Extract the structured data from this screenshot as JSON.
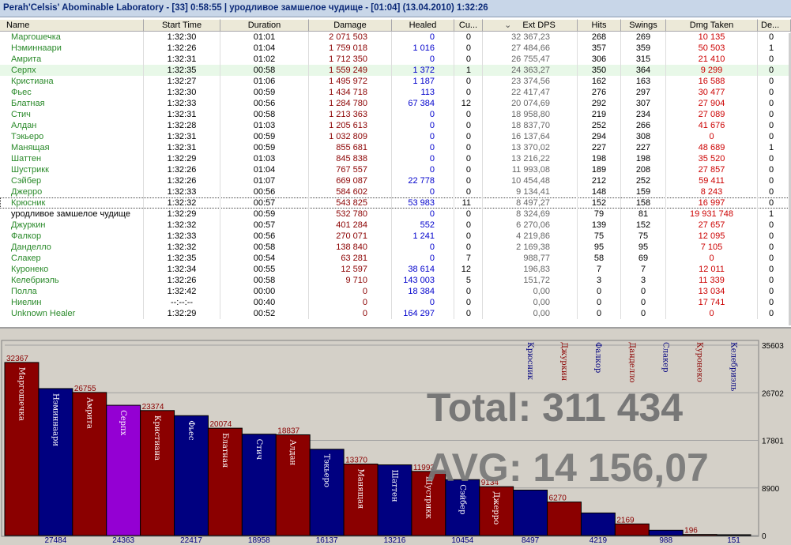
{
  "window": {
    "title": "Perah'Celsis' Abominable Laboratory - [33] 0:58:55 | уродливое замшелое чудище - [01:04] (13.04.2010) 1:32:26"
  },
  "table": {
    "columns": [
      "Name",
      "Start Time",
      "Duration",
      "Damage",
      "Healed",
      "Cu...",
      "Ext DPS",
      "Hits",
      "Swings",
      "Dmg Taken",
      "De..."
    ],
    "sort_indicator": "⌄",
    "rows": [
      {
        "name": "Маргошечка",
        "start": "1:32:30",
        "dur": "01:01",
        "dmg": "2 071 503",
        "healed": "0",
        "cu": "0",
        "dps": "32 367,23",
        "hits": "268",
        "swings": "269",
        "taken": "10 135",
        "de": "0"
      },
      {
        "name": "Нэминнаари",
        "start": "1:32:26",
        "dur": "01:04",
        "dmg": "1 759 018",
        "healed": "1 016",
        "cu": "0",
        "dps": "27 484,66",
        "hits": "357",
        "swings": "359",
        "taken": "50 503",
        "de": "1"
      },
      {
        "name": "Амрита",
        "start": "1:32:31",
        "dur": "01:02",
        "dmg": "1 712 350",
        "healed": "0",
        "cu": "0",
        "dps": "26 755,47",
        "hits": "306",
        "swings": "315",
        "taken": "21 410",
        "de": "0"
      },
      {
        "name": "Серпх",
        "start": "1:32:35",
        "dur": "00:58",
        "dmg": "1 559 249",
        "healed": "1 372",
        "cu": "1",
        "dps": "24 363,27",
        "hits": "350",
        "swings": "364",
        "taken": "9 299",
        "de": "0"
      },
      {
        "name": "Кристиана",
        "start": "1:32:27",
        "dur": "01:06",
        "dmg": "1 495 972",
        "healed": "1 187",
        "cu": "0",
        "dps": "23 374,56",
        "hits": "162",
        "swings": "163",
        "taken": "16 588",
        "de": "0"
      },
      {
        "name": "Фьес",
        "start": "1:32:30",
        "dur": "00:59",
        "dmg": "1 434 718",
        "healed": "113",
        "cu": "0",
        "dps": "22 417,47",
        "hits": "276",
        "swings": "297",
        "taken": "30 477",
        "de": "0"
      },
      {
        "name": "Блатная",
        "start": "1:32:33",
        "dur": "00:56",
        "dmg": "1 284 780",
        "healed": "67 384",
        "cu": "12",
        "dps": "20 074,69",
        "hits": "292",
        "swings": "307",
        "taken": "27 904",
        "de": "0"
      },
      {
        "name": "Стич",
        "start": "1:32:31",
        "dur": "00:58",
        "dmg": "1 213 363",
        "healed": "0",
        "cu": "0",
        "dps": "18 958,80",
        "hits": "219",
        "swings": "234",
        "taken": "27 089",
        "de": "0"
      },
      {
        "name": "Алдан",
        "start": "1:32:28",
        "dur": "01:03",
        "dmg": "1 205 613",
        "healed": "0",
        "cu": "0",
        "dps": "18 837,70",
        "hits": "252",
        "swings": "266",
        "taken": "41 676",
        "de": "0"
      },
      {
        "name": "Тэкьеро",
        "start": "1:32:31",
        "dur": "00:59",
        "dmg": "1 032 809",
        "healed": "0",
        "cu": "0",
        "dps": "16 137,64",
        "hits": "294",
        "swings": "308",
        "taken": "0",
        "de": "0"
      },
      {
        "name": "Манящая",
        "start": "1:32:31",
        "dur": "00:59",
        "dmg": "855 681",
        "healed": "0",
        "cu": "0",
        "dps": "13 370,02",
        "hits": "227",
        "swings": "227",
        "taken": "48 689",
        "de": "1"
      },
      {
        "name": "Шаттен",
        "start": "1:32:29",
        "dur": "01:03",
        "dmg": "845 838",
        "healed": "0",
        "cu": "0",
        "dps": "13 216,22",
        "hits": "198",
        "swings": "198",
        "taken": "35 520",
        "de": "0"
      },
      {
        "name": "Шустрикк",
        "start": "1:32:26",
        "dur": "01:04",
        "dmg": "767 557",
        "healed": "0",
        "cu": "0",
        "dps": "11 993,08",
        "hits": "189",
        "swings": "208",
        "taken": "27 857",
        "de": "0"
      },
      {
        "name": "Сэйбер",
        "start": "1:32:26",
        "dur": "01:07",
        "dmg": "669 087",
        "healed": "22 778",
        "cu": "0",
        "dps": "10 454,48",
        "hits": "212",
        "swings": "252",
        "taken": "59 411",
        "de": "0"
      },
      {
        "name": "Джерро",
        "start": "1:32:33",
        "dur": "00:56",
        "dmg": "584 602",
        "healed": "0",
        "cu": "0",
        "dps": "9 134,41",
        "hits": "148",
        "swings": "159",
        "taken": "8 243",
        "de": "0"
      },
      {
        "name": "Крюсник",
        "start": "1:32:32",
        "dur": "00:57",
        "dmg": "543 825",
        "healed": "53 983",
        "cu": "11",
        "dps": "8 497,27",
        "hits": "152",
        "swings": "158",
        "taken": "16 997",
        "de": "0"
      },
      {
        "name": "уродливое замшелое чудище",
        "start": "1:32:29",
        "dur": "00:59",
        "dmg": "532 780",
        "healed": "0",
        "cu": "0",
        "dps": "8 324,69",
        "hits": "79",
        "swings": "81",
        "taken": "19 931 748",
        "de": "1"
      },
      {
        "name": "Джуркин",
        "start": "1:32:32",
        "dur": "00:57",
        "dmg": "401 284",
        "healed": "552",
        "cu": "0",
        "dps": "6 270,06",
        "hits": "139",
        "swings": "152",
        "taken": "27 657",
        "de": "0"
      },
      {
        "name": "Фалкор",
        "start": "1:32:33",
        "dur": "00:56",
        "dmg": "270 071",
        "healed": "1 241",
        "cu": "0",
        "dps": "4 219,86",
        "hits": "75",
        "swings": "75",
        "taken": "12 095",
        "de": "0"
      },
      {
        "name": "Данделло",
        "start": "1:32:32",
        "dur": "00:58",
        "dmg": "138 840",
        "healed": "0",
        "cu": "0",
        "dps": "2 169,38",
        "hits": "95",
        "swings": "95",
        "taken": "7 105",
        "de": "0"
      },
      {
        "name": "Слакер",
        "start": "1:32:35",
        "dur": "00:54",
        "dmg": "63 281",
        "healed": "0",
        "cu": "7",
        "dps": "988,77",
        "hits": "58",
        "swings": "69",
        "taken": "0",
        "de": "0"
      },
      {
        "name": "Куронеко",
        "start": "1:32:34",
        "dur": "00:55",
        "dmg": "12 597",
        "healed": "38 614",
        "cu": "12",
        "dps": "196,83",
        "hits": "7",
        "swings": "7",
        "taken": "12 011",
        "de": "0"
      },
      {
        "name": "Келебриэль",
        "start": "1:32:26",
        "dur": "00:58",
        "dmg": "9 710",
        "healed": "143 003",
        "cu": "5",
        "dps": "151,72",
        "hits": "3",
        "swings": "3",
        "taken": "11 339",
        "de": "0"
      },
      {
        "name": "Полла",
        "start": "1:32:42",
        "dur": "00:00",
        "dmg": "0",
        "healed": "18 384",
        "cu": "0",
        "dps": "0,00",
        "hits": "0",
        "swings": "0",
        "taken": "13 034",
        "de": "0"
      },
      {
        "name": "Ниелин",
        "start": "--:--:--",
        "dur": "00:40",
        "dmg": "0",
        "healed": "0",
        "cu": "0",
        "dps": "0,00",
        "hits": "0",
        "swings": "0",
        "taken": "17 741",
        "de": "0"
      },
      {
        "name": "Unknown Healer",
        "start": "1:32:29",
        "dur": "00:52",
        "dmg": "0",
        "healed": "164 297",
        "cu": "0",
        "dps": "0,00",
        "hits": "0",
        "swings": "0",
        "taken": "0",
        "de": "0"
      }
    ]
  },
  "chart_data": {
    "type": "bar",
    "categories": [
      "Маргошечка",
      "Нэминнаари",
      "Амрита",
      "Серпх",
      "Кристиана",
      "Фьес",
      "Блатная",
      "Стич",
      "Алдан",
      "Тэкьеро",
      "Манящая",
      "Шаттен",
      "Шустрикк",
      "Сэйбер",
      "Джерро",
      "Крюсник",
      "Джуркин",
      "Фалкор",
      "Данделло",
      "Слакер",
      "Куронеко",
      "Келебриэль"
    ],
    "values": [
      32367,
      27484,
      26755,
      24363,
      23374,
      22417,
      20074,
      18958,
      18837,
      16137,
      13370,
      13216,
      11993,
      10454,
      9134,
      8497,
      6270,
      4219,
      2169,
      988,
      196,
      151
    ],
    "value_labels": [
      "32367",
      "27484",
      "26755",
      "24363",
      "23374",
      "22417",
      "20074",
      "18958",
      "18837",
      "16137",
      "13370",
      "13216",
      "11993",
      "10454",
      "9134",
      "8497",
      "6270",
      "4219",
      "2169",
      "988",
      "196",
      "151"
    ],
    "bar_colors": [
      "#8b0000",
      "#000080",
      "#8b0000",
      "#9400d3",
      "#8b0000",
      "#000080",
      "#8b0000",
      "#000080",
      "#8b0000",
      "#000080",
      "#8b0000",
      "#000080",
      "#8b0000",
      "#000080",
      "#8b0000",
      "#000080",
      "#8b0000",
      "#000080",
      "#8b0000",
      "#000080",
      "#8b0000",
      "#000080"
    ],
    "label_in_bar_count": 15,
    "ylim": [
      0,
      35603
    ],
    "yticks": [
      "35603",
      "26702",
      "17801",
      "8900",
      "0"
    ],
    "ytick_values": [
      35603,
      26702,
      17801,
      8900,
      0
    ],
    "grid": true,
    "total_text": "Total: 311 434",
    "avg_text": "AVG: 14 156,07"
  },
  "colors": {
    "red_bar": "#8b0000",
    "blue_bar": "#000080",
    "highlight_bar": "#9400d3",
    "player_name": "#2a8a2a",
    "damage": "#8b0000",
    "healed": "#0000cc",
    "dmg_taken": "#cc0000"
  }
}
